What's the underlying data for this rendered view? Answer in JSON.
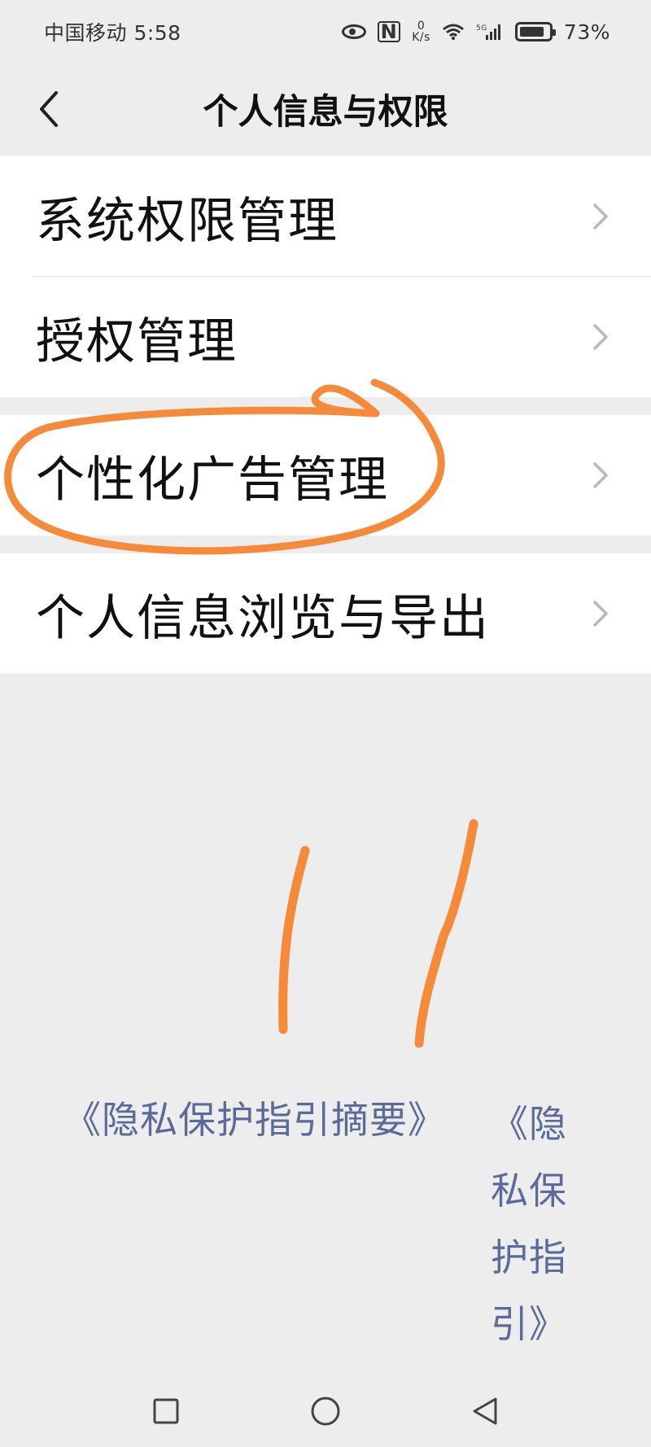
{
  "status_bar": {
    "carrier_time": "中国移动 5:58",
    "net_speed_value": "0",
    "net_speed_unit": "K/s",
    "network_type": "5G",
    "battery": "73%"
  },
  "header": {
    "title": "个人信息与权限",
    "back_icon": "chevron-left-icon"
  },
  "menu": {
    "groups": [
      {
        "items": [
          {
            "label": "系统权限管理"
          },
          {
            "label": "授权管理"
          }
        ]
      },
      {
        "items": [
          {
            "label": "个性化广告管理"
          }
        ]
      },
      {
        "items": [
          {
            "label": "个人信息浏览与导出"
          }
        ]
      }
    ]
  },
  "links": {
    "summary": "《隐私保护指引摘要》",
    "full_lines": [
      "《隐",
      "私保",
      "护指",
      "引》"
    ]
  },
  "annotation": {
    "color": "#f58a3a",
    "circled_item": "个性化广告管理"
  },
  "system_nav": {
    "recents_icon": "square-icon",
    "home_icon": "circle-icon",
    "back_icon": "triangle-back-icon"
  }
}
